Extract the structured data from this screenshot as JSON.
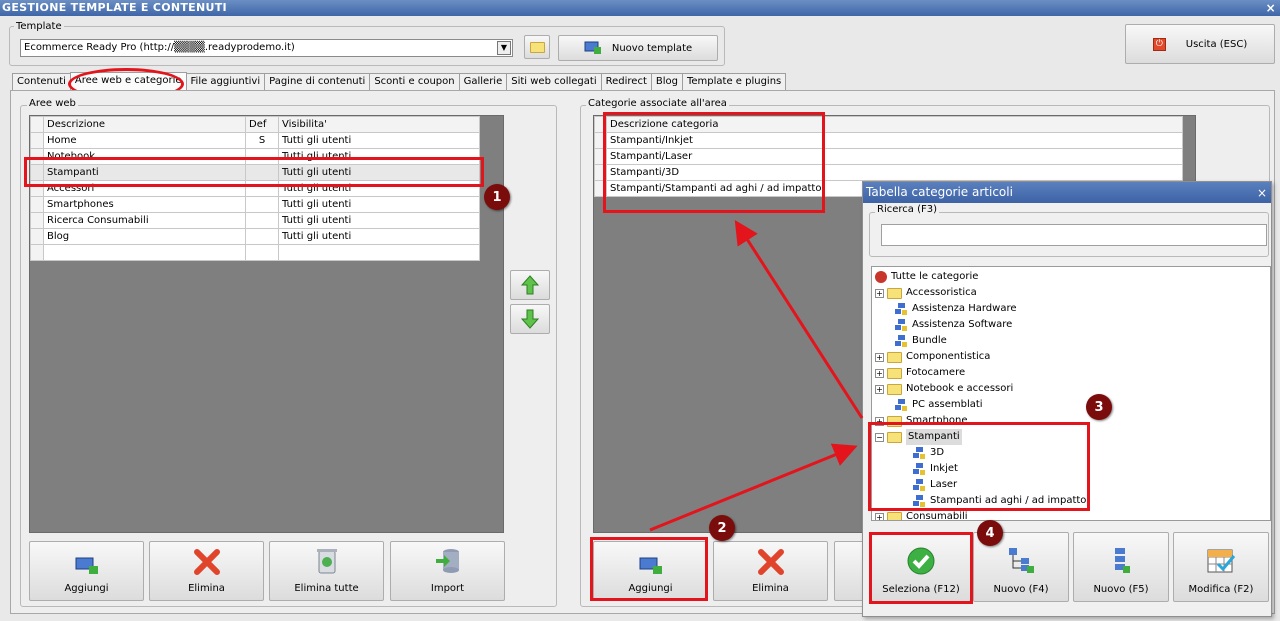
{
  "window": {
    "title": "GESTIONE TEMPLATE E CONTENUTI",
    "close": "×"
  },
  "template_group": {
    "legend": "Template",
    "selected": "Ecommerce Ready Pro (http://▒▒▒▒.readyprodemo.it)",
    "new_template": "Nuovo template",
    "exit": "Uscita (ESC)"
  },
  "tabs": [
    "Contenuti",
    "Aree web e categorie",
    "File aggiuntivi",
    "Pagine di contenuti",
    "Sconti e coupon",
    "Gallerie",
    "Siti web collegati",
    "Redirect",
    "Blog",
    "Template e plugins"
  ],
  "aree_web": {
    "legend": "Aree web",
    "columns": [
      "Descrizione",
      "Def",
      "Visibilita'"
    ],
    "rows": [
      [
        "Home",
        "S",
        "Tutti gli utenti"
      ],
      [
        "Notebook",
        "",
        "Tutti gli utenti"
      ],
      [
        "Stampanti",
        "",
        "Tutti gli utenti"
      ],
      [
        "Accessori",
        "",
        "Tutti gli utenti"
      ],
      [
        "Smartphones",
        "",
        "Tutti gli utenti"
      ],
      [
        "Ricerca Consumabili",
        "",
        "Tutti gli utenti"
      ],
      [
        "Blog",
        "",
        "Tutti gli utenti"
      ]
    ],
    "buttons": [
      "Aggiungi",
      "Elimina",
      "Elimina tutte",
      "Import"
    ]
  },
  "categorie_area": {
    "legend": "Categorie associate all'area",
    "column": "Descrizione categoria",
    "rows": [
      "Stampanti/Inkjet",
      "Stampanti/Laser",
      "Stampanti/3D",
      "Stampanti/Stampanti ad aghi / ad impatto"
    ],
    "buttons": [
      "Aggiungi",
      "Elimina"
    ]
  },
  "panel": {
    "title": "Tabella categorie articoli",
    "search_legend": "Ricerca (F3)",
    "search_value": "",
    "tree": [
      {
        "label": "Tutte le categorie",
        "type": "root",
        "level": 0
      },
      {
        "label": "Accessoristica",
        "type": "folder",
        "level": 1,
        "exp": "+"
      },
      {
        "label": "Assistenza Hardware",
        "type": "leaf",
        "level": 1
      },
      {
        "label": "Assistenza Software",
        "type": "leaf",
        "level": 1
      },
      {
        "label": "Bundle",
        "type": "leaf",
        "level": 1
      },
      {
        "label": "Componentistica",
        "type": "folder",
        "level": 1,
        "exp": "+"
      },
      {
        "label": "Fotocamere",
        "type": "folder",
        "level": 1,
        "exp": "+"
      },
      {
        "label": "Notebook e accessori",
        "type": "folder",
        "level": 1,
        "exp": "+"
      },
      {
        "label": "PC assemblati",
        "type": "leaf",
        "level": 1
      },
      {
        "label": "Smartphone",
        "type": "folder",
        "level": 1,
        "exp": "+"
      },
      {
        "label": "Stampanti",
        "type": "folder",
        "level": 1,
        "exp": "−",
        "selected": true
      },
      {
        "label": "3D",
        "type": "leaf",
        "level": 2
      },
      {
        "label": "Inkjet",
        "type": "leaf",
        "level": 2
      },
      {
        "label": "Laser",
        "type": "leaf",
        "level": 2
      },
      {
        "label": "Stampanti ad aghi / ad impatto",
        "type": "leaf",
        "level": 2
      },
      {
        "label": "Consumabili",
        "type": "folder",
        "level": 1,
        "exp": "+"
      }
    ],
    "buttons": [
      "Seleziona (F12)",
      "Nuovo (F4)",
      "Nuovo (F5)",
      "Modifica (F2)"
    ]
  },
  "badges": [
    "1",
    "2",
    "3",
    "4"
  ],
  "colors": {
    "annotation": "#e3141b",
    "badge": "#7a0c0c",
    "title": "#3f66a8"
  }
}
